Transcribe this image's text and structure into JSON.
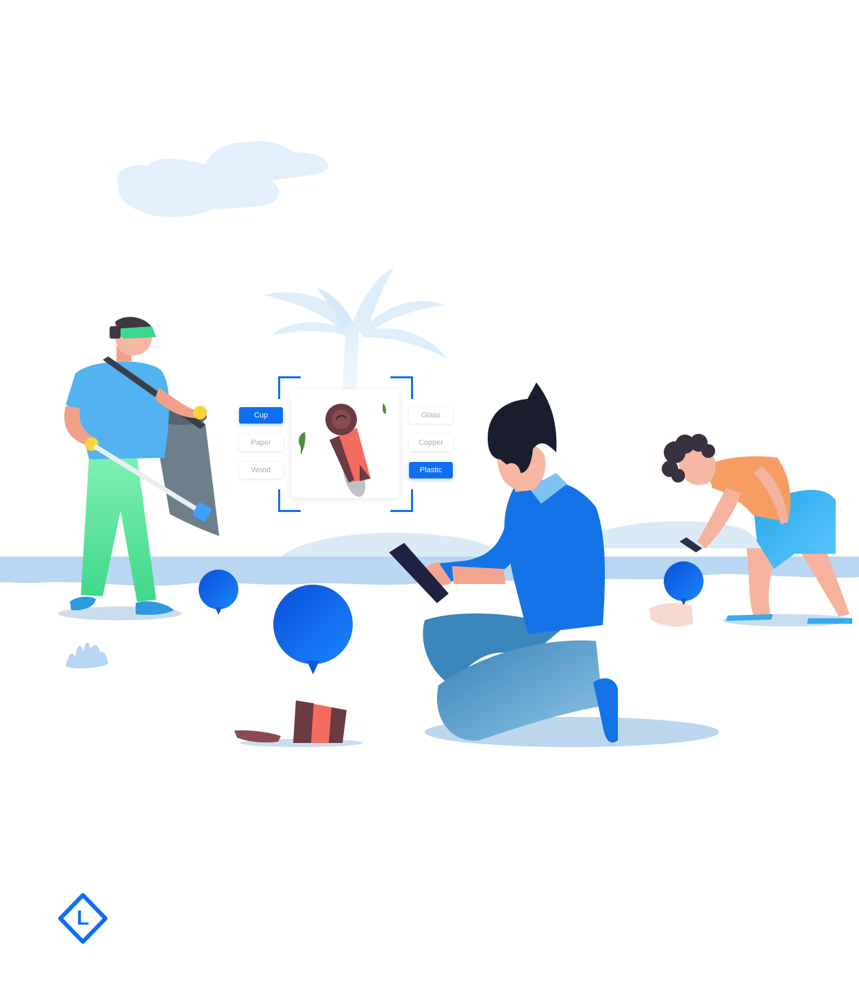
{
  "labels": {
    "left": [
      "Cup",
      "Paper",
      "Wood"
    ],
    "right": [
      "Glass",
      "Copper",
      "Plastic"
    ]
  },
  "selected": {
    "left": "Cup",
    "right": "Plastic"
  },
  "logo": {
    "letter": "L"
  },
  "colors": {
    "accent": "#0f6ff2",
    "chip_inactive_text": "#a7adb5",
    "sky_light": "#e3f0fb",
    "water": "#b9d6f2"
  },
  "icons": {
    "location_pins": "map-pin-icon",
    "logo": "diamond-logo-icon"
  }
}
